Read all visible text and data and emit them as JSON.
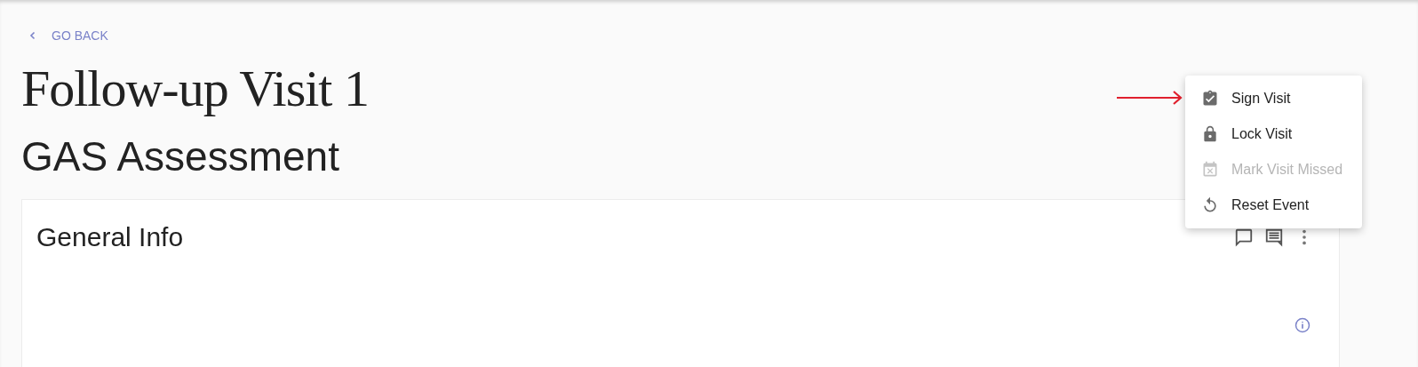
{
  "back_link": {
    "label": "GO BACK"
  },
  "page_title": "Follow-up Visit 1",
  "section_title": "GAS Assessment",
  "card": {
    "title": "General Info"
  },
  "menu": {
    "items": [
      {
        "kind": "sign",
        "label": "Sign Visit",
        "disabled": false
      },
      {
        "kind": "lock",
        "label": "Lock Visit",
        "disabled": false
      },
      {
        "kind": "missed",
        "label": "Mark Visit Missed",
        "disabled": true
      },
      {
        "kind": "reset",
        "label": "Reset Event",
        "disabled": false
      }
    ]
  }
}
